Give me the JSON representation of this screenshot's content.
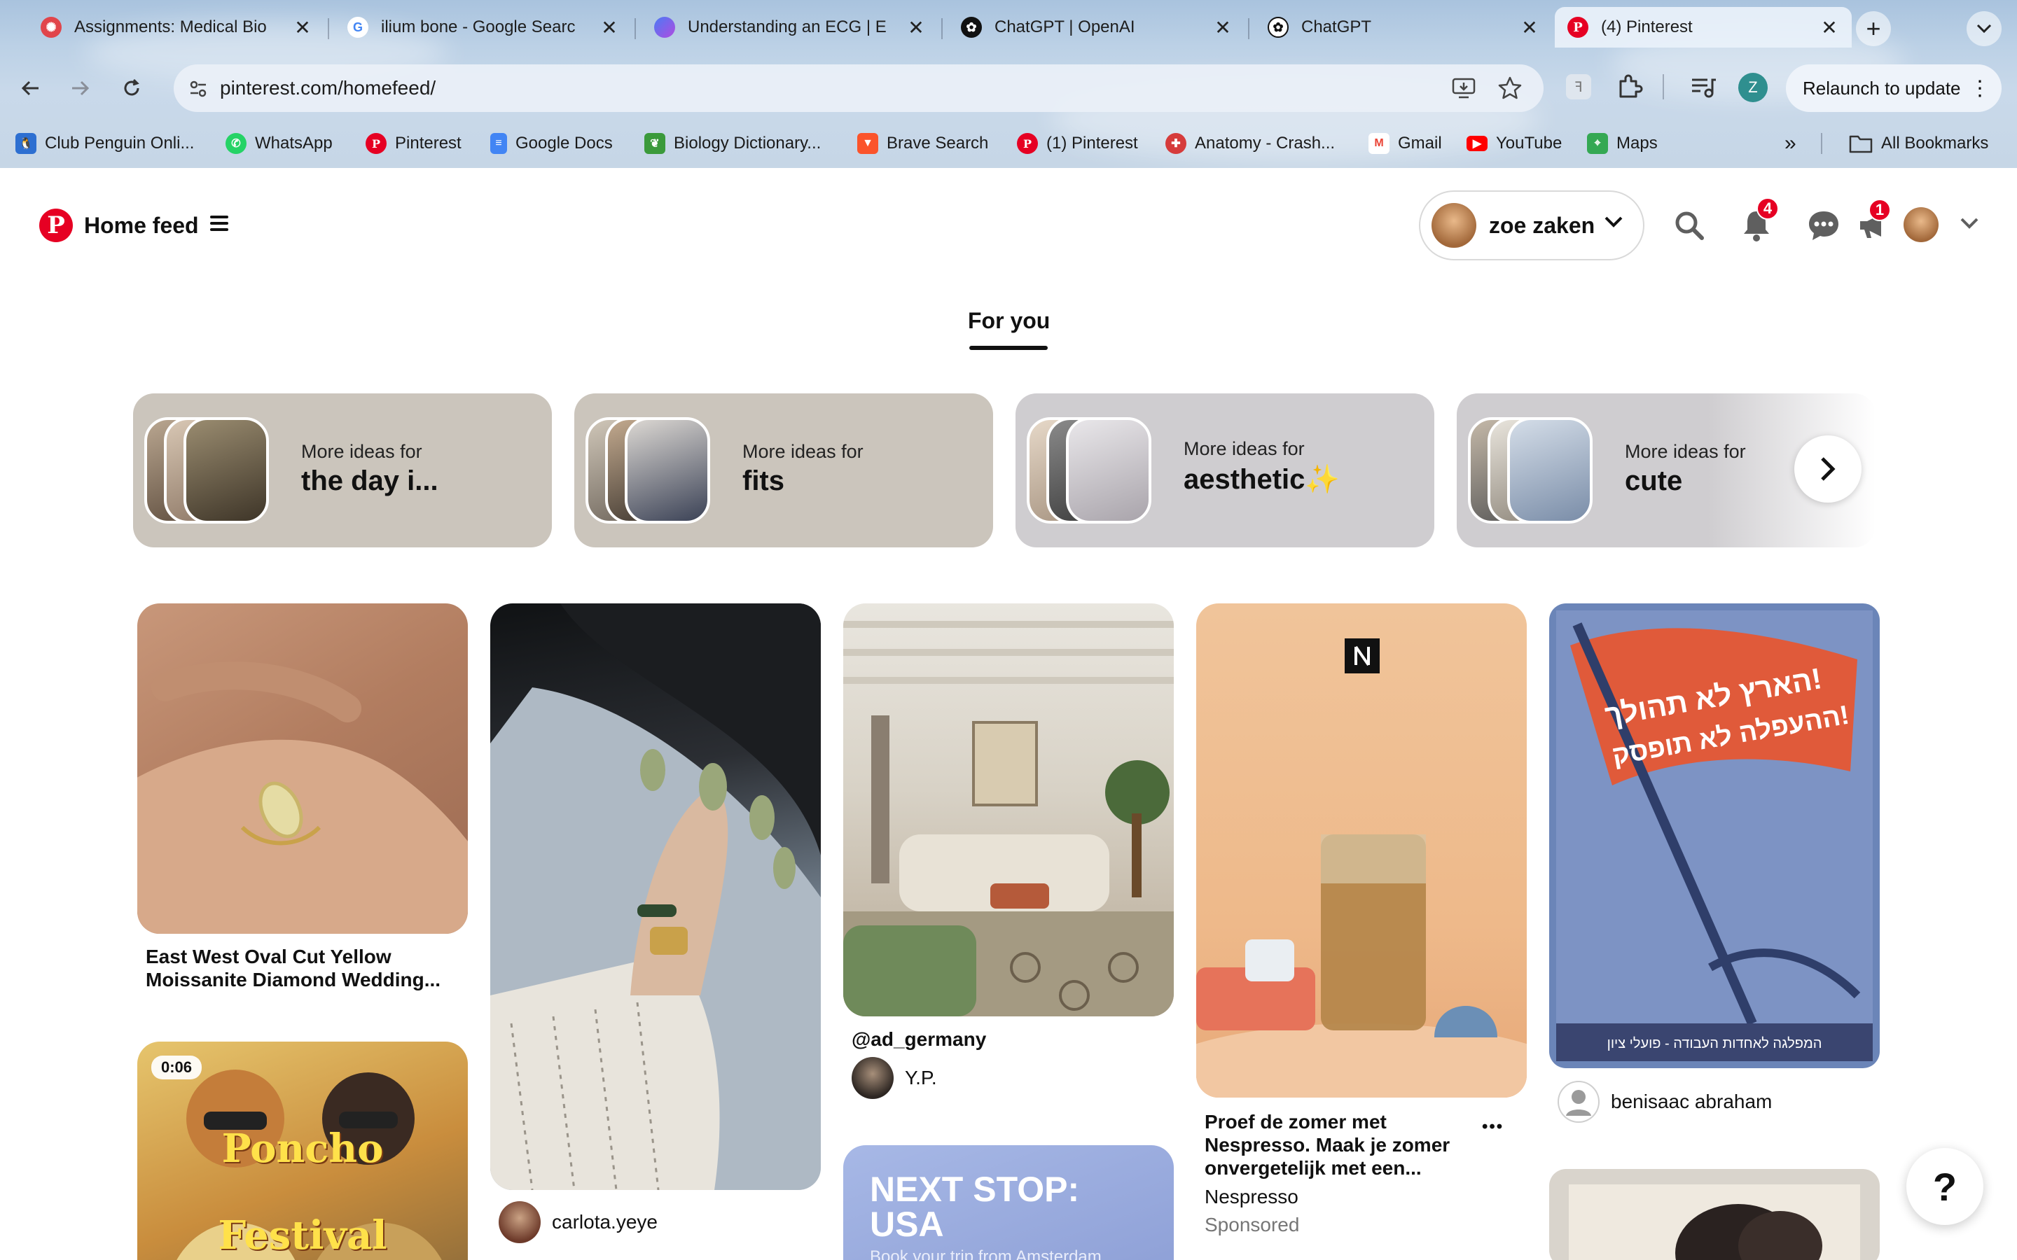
{
  "browser": {
    "tabs": [
      {
        "title": "Assignments: Medical Bio",
        "icon": "canvas-icon",
        "color": "#e1454b"
      },
      {
        "title": "ilium bone - Google Searc",
        "icon": "google-icon",
        "color": "#4285f4"
      },
      {
        "title": "Understanding an ECG | E",
        "icon": "ecg-site-icon",
        "color": "#6d6bf0"
      },
      {
        "title": "ChatGPT | OpenAI",
        "icon": "openai-icon",
        "color": "#111111"
      },
      {
        "title": "ChatGPT",
        "icon": "openai-icon",
        "color": "#111111"
      },
      {
        "title": "(4) Pinterest",
        "icon": "pinterest-icon",
        "color": "#e60023"
      }
    ],
    "new_tab": "+",
    "url": "pinterest.com/homefeed/",
    "relaunch_label": "Relaunch to update",
    "profile_initial": "Z",
    "bookmarks": [
      {
        "label": "Club Penguin Onli...",
        "icon": "club-penguin-icon",
        "color": "#2d6fd1"
      },
      {
        "label": "WhatsApp",
        "icon": "whatsapp-icon",
        "color": "#25d366"
      },
      {
        "label": "Pinterest",
        "icon": "pinterest-icon",
        "color": "#e60023"
      },
      {
        "label": "Google Docs",
        "icon": "google-docs-icon",
        "color": "#4285f4"
      },
      {
        "label": "Biology Dictionary...",
        "icon": "biology-dictionary-icon",
        "color": "#3b9a3b"
      },
      {
        "label": "Brave Search",
        "icon": "brave-icon",
        "color": "#fb542b"
      },
      {
        "label": "(1) Pinterest",
        "icon": "pinterest-icon",
        "color": "#e60023"
      },
      {
        "label": "Anatomy - Crash...",
        "icon": "crash-course-icon",
        "color": "#d63b3b"
      },
      {
        "label": "Gmail",
        "icon": "gmail-icon",
        "color": "#ea4335"
      },
      {
        "label": "YouTube",
        "icon": "youtube-icon",
        "color": "#ff0000"
      },
      {
        "label": "Maps",
        "icon": "maps-icon",
        "color": "#34a853"
      }
    ],
    "overflow": "»",
    "all_bookmarks": "All Bookmarks"
  },
  "header": {
    "title": "Home feed",
    "account_name": "zoe zaken",
    "notifications_count": "4",
    "updates_count": "1",
    "brand_color": "#e60023"
  },
  "feed_tabs": {
    "active": "For you"
  },
  "ideas": [
    {
      "prefix": "More ideas for",
      "topic": "the day i..."
    },
    {
      "prefix": "More ideas for",
      "topic": "fits"
    },
    {
      "prefix": "More ideas for",
      "topic": "aesthetic",
      "emoji": "✨"
    },
    {
      "prefix": "More ideas for",
      "topic": "cute"
    }
  ],
  "pins": {
    "ring": {
      "title": "East West Oval Cut Yellow Moissanite Diamond Wedding..."
    },
    "video": {
      "duration": "0:06",
      "overlay_line1": "Poncho",
      "overlay_line2": "Festival"
    },
    "nails": {
      "creator": "carlota.yeye"
    },
    "room": {
      "title": "@ad_germany",
      "creator": "Y.P."
    },
    "travel": {
      "headline_line1": "NEXT STOP:",
      "headline_line2": "USA",
      "sub": "Book your trip from Amsterdam"
    },
    "nespresso": {
      "title": "Proef de zomer met Nespresso. Maak je zomer onvergetelijk met een...",
      "advertiser": "Nespresso",
      "sponsored": "Sponsored",
      "more": "•••"
    },
    "poster": {
      "creator": "benisaac abraham",
      "banner_line1": "!הארץ לא תהולך",
      "banner_line2": "!ההעפלה לא תופסק",
      "footer": "המפלגה לאחדות העבודה - פועלי ציון"
    }
  },
  "help_label": "?"
}
